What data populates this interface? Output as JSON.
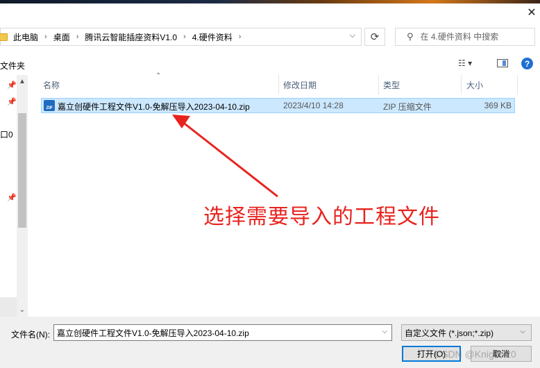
{
  "window": {
    "close_glyph": "✕"
  },
  "address": {
    "crumbs": [
      "此电脑",
      "桌面",
      "腾讯云智能插座资料V1.0",
      "4.硬件资料"
    ],
    "refresh_glyph": "⟳"
  },
  "search": {
    "placeholder": "在 4.硬件资料 中搜索",
    "icon": "search-icon"
  },
  "toolbar": {
    "new_folder_label": "文件夹",
    "view_glyph": "☷ ▾",
    "help_label": "?"
  },
  "nav": {
    "visible_text": "口0",
    "pin_icon": "pin-icon"
  },
  "columns": {
    "name": "名称",
    "date": "修改日期",
    "type": "类型",
    "size": "大小"
  },
  "files": [
    {
      "name": "嘉立创硬件工程文件V1.0-免解压导入2023-04-10.zip",
      "date": "2023/4/10 14:28",
      "type": "ZIP 压缩文件",
      "size": "369 KB",
      "icon_label": "ZIP"
    }
  ],
  "annotation": {
    "text": "选择需要导入的工程文件",
    "color": "#e8231e"
  },
  "bottom": {
    "filename_label": "文件名(N):",
    "filename_value": "嘉立创硬件工程文件V1.0-免解压导入2023-04-10.zip",
    "filter_value": "自定义文件 (*.json;*.zip)",
    "open_label": "打开(O)",
    "cancel_label": "取消"
  },
  "watermark": "CSDN @Knight-20",
  "colors": {
    "selection": "#cce8ff",
    "accent": "#0078d7"
  }
}
